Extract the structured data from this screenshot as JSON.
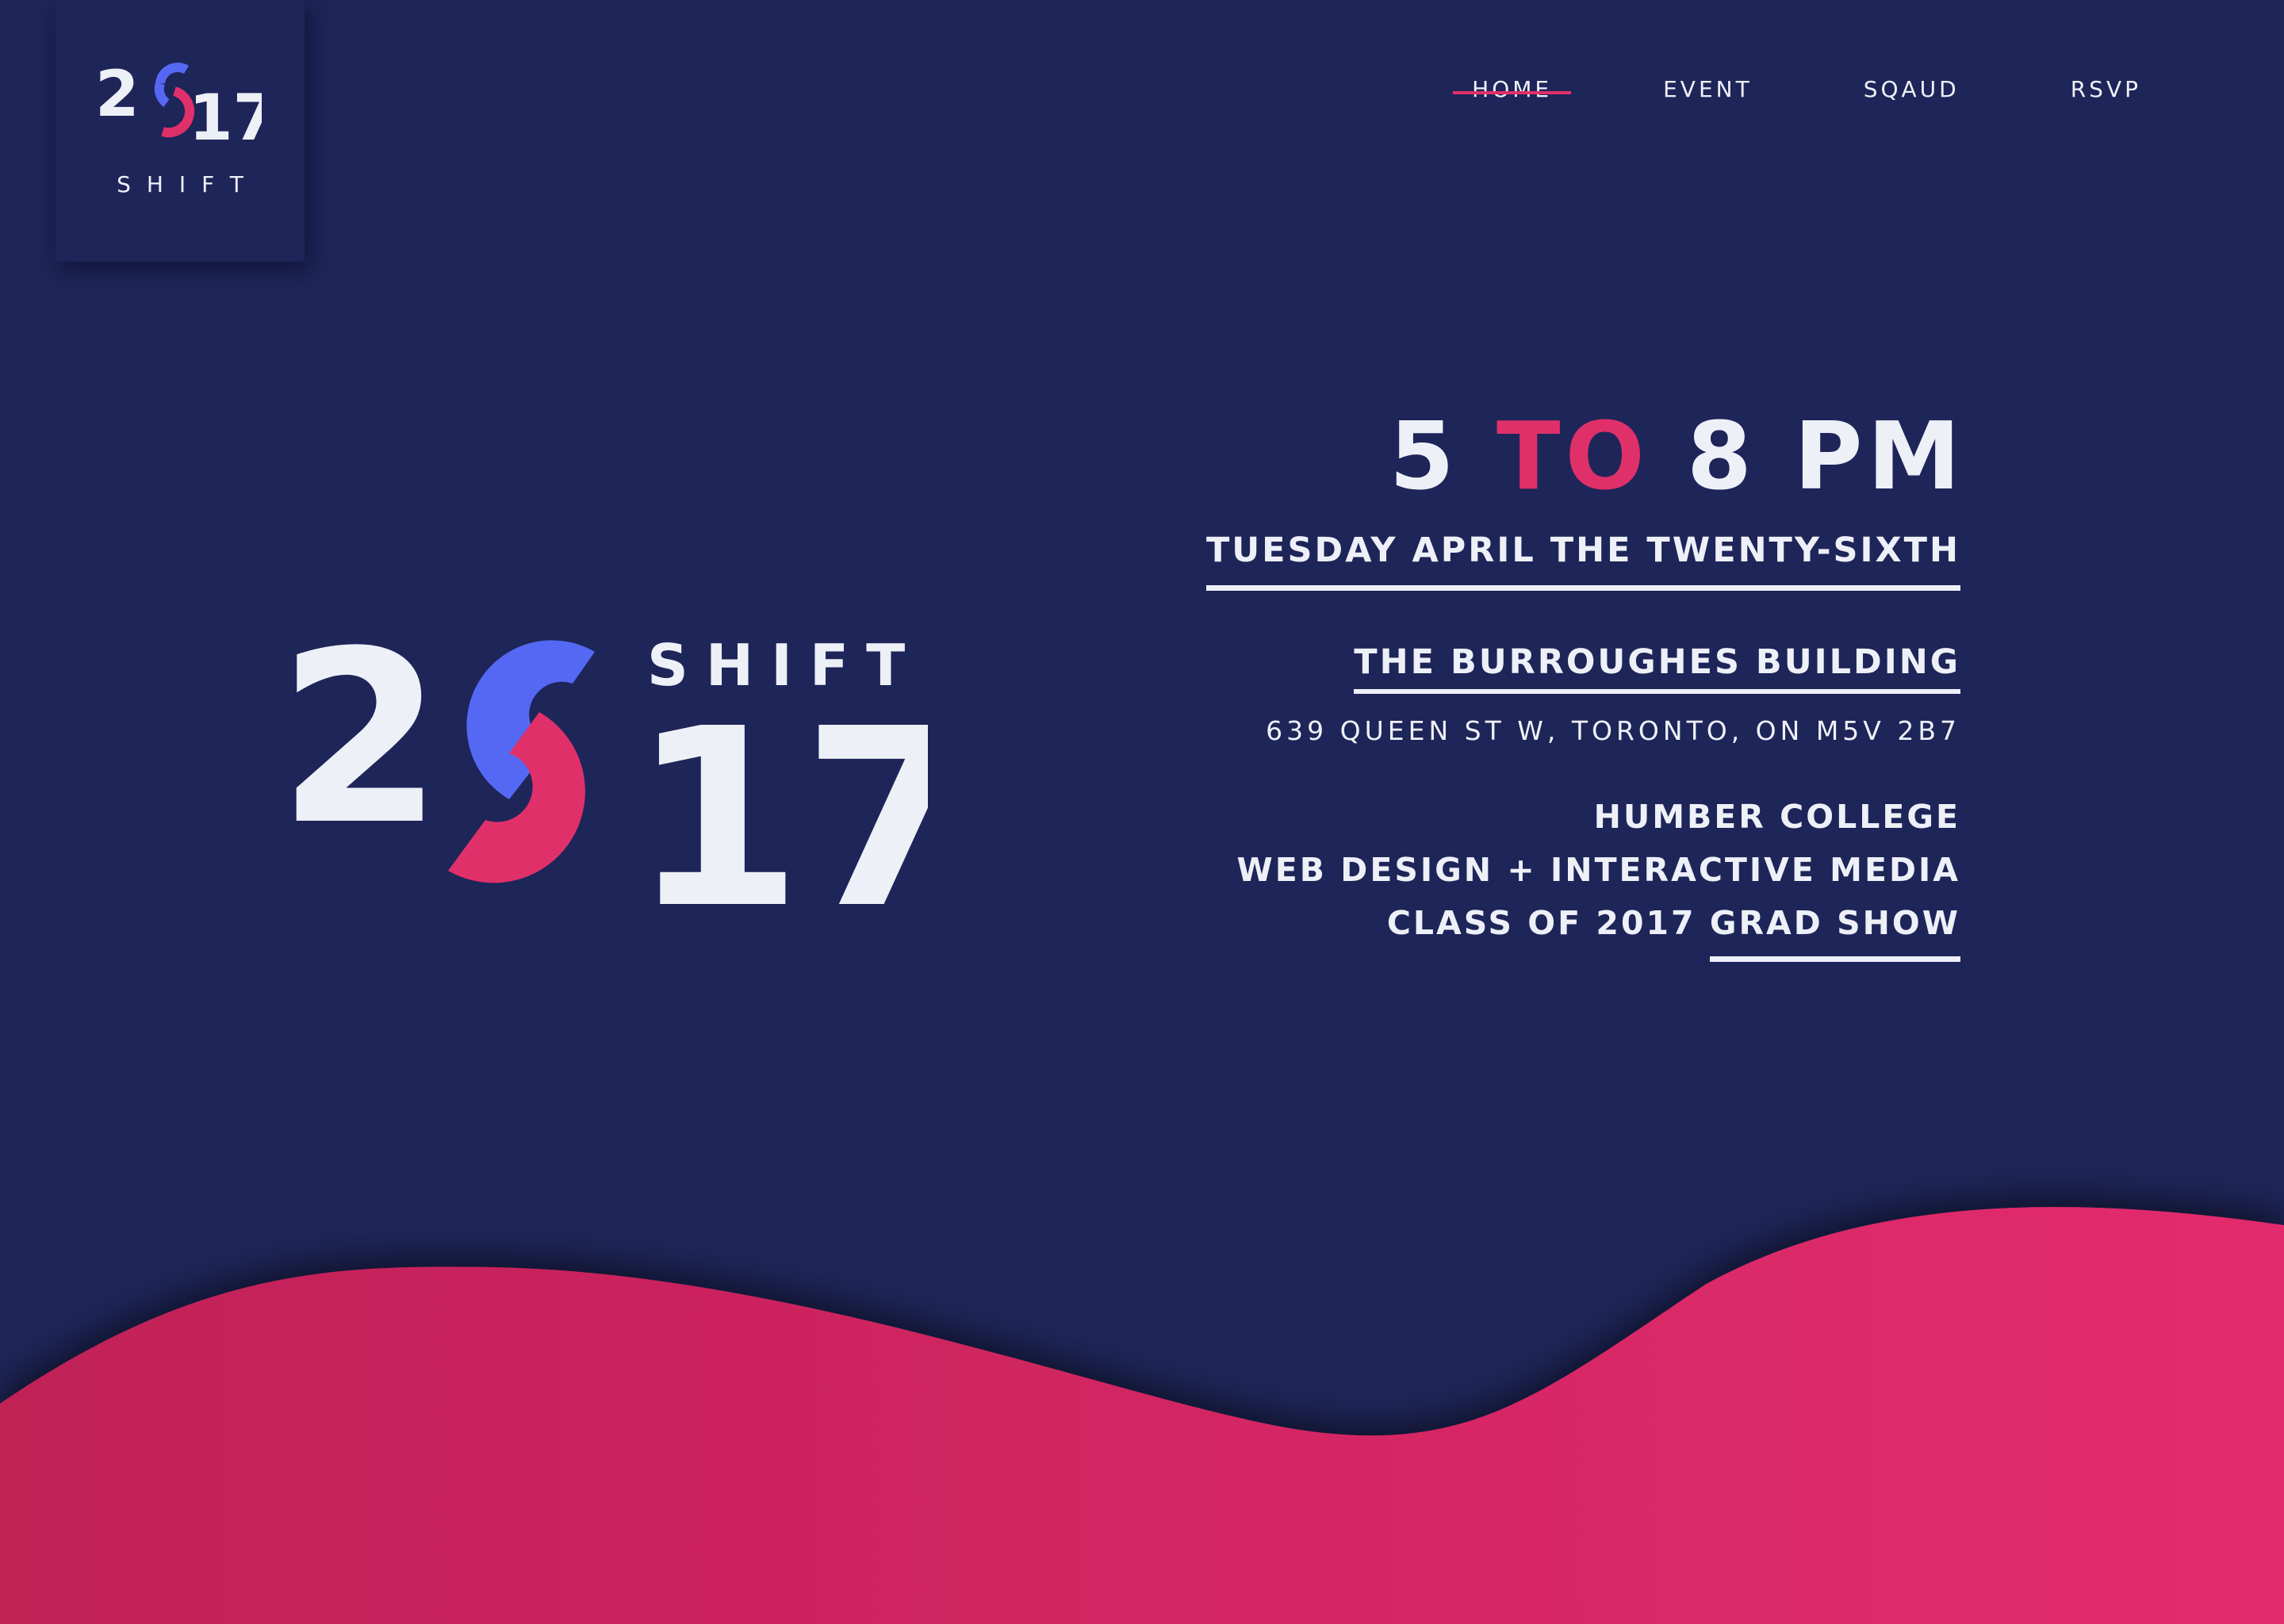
{
  "colors": {
    "background": "#1e2558",
    "accent_pink": "#e0306a",
    "accent_blue": "#5468f3",
    "text": "#eef0f8"
  },
  "badge": {
    "year_left": "2",
    "year_right": "17",
    "wordmark": "SHIFT"
  },
  "nav": {
    "items": [
      {
        "label": "HOME",
        "active": true
      },
      {
        "label": "EVENT",
        "active": false
      },
      {
        "label": "SQAUD",
        "active": false
      },
      {
        "label": "RSVP",
        "active": false
      }
    ]
  },
  "hero": {
    "year_left": "2",
    "year_right": "17",
    "wordmark": "SHIFT"
  },
  "event": {
    "time_start": "5",
    "time_connector": "TO",
    "time_end": "8 PM",
    "date": "TUESDAY APRIL THE TWENTY-SIXTH",
    "venue": "THE BURROUGHES BUILDING",
    "address": "639 QUEEN ST W, TORONTO, ON M5V 2B7",
    "org_line_1": "HUMBER COLLEGE",
    "org_line_2": "WEB DESIGN + INTERACTIVE MEDIA",
    "org_line_3_prefix": "CLASS OF 2017",
    "org_line_3_link": "GRAD SHOW"
  }
}
